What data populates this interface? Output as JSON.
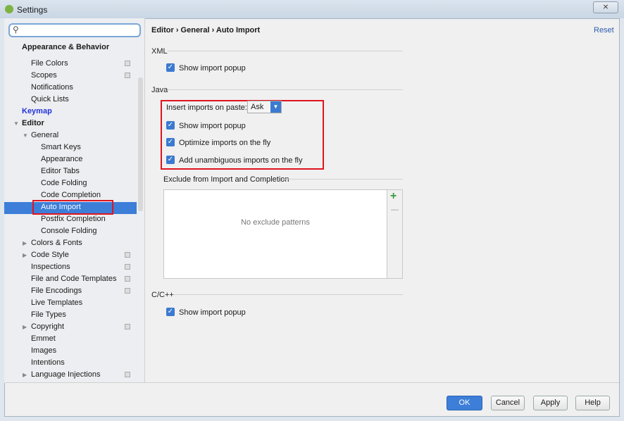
{
  "window": {
    "title": "Settings",
    "close": "⨯"
  },
  "search": {
    "placeholder": ""
  },
  "sidebar": {
    "sticky_header": "Appearance & Behavior",
    "items": [
      {
        "label": "File Colors",
        "level": 2,
        "copy": true
      },
      {
        "label": "Scopes",
        "level": 2,
        "copy": true
      },
      {
        "label": "Notifications",
        "level": 2
      },
      {
        "label": "Quick Lists",
        "level": 2
      },
      {
        "label": "Keymap",
        "level": 1,
        "style": "bold-blue"
      },
      {
        "label": "Editor",
        "level": 1,
        "style": "bold",
        "arrow": "down"
      },
      {
        "label": "General",
        "level": 2,
        "arrow": "down"
      },
      {
        "label": "Smart Keys",
        "level": 3
      },
      {
        "label": "Appearance",
        "level": 3
      },
      {
        "label": "Editor Tabs",
        "level": 3
      },
      {
        "label": "Code Folding",
        "level": 3
      },
      {
        "label": "Code Completion",
        "level": 3
      },
      {
        "label": "Auto Import",
        "level": 3,
        "selected": true
      },
      {
        "label": "Postfix Completion",
        "level": 3
      },
      {
        "label": "Console Folding",
        "level": 3
      },
      {
        "label": "Colors & Fonts",
        "level": 2,
        "arrow": "right"
      },
      {
        "label": "Code Style",
        "level": 2,
        "arrow": "right",
        "copy": true
      },
      {
        "label": "Inspections",
        "level": 2,
        "copy": true
      },
      {
        "label": "File and Code Templates",
        "level": 2,
        "copy": true
      },
      {
        "label": "File Encodings",
        "level": 2,
        "copy": true
      },
      {
        "label": "Live Templates",
        "level": 2
      },
      {
        "label": "File Types",
        "level": 2
      },
      {
        "label": "Copyright",
        "level": 2,
        "arrow": "right",
        "copy": true
      },
      {
        "label": "Emmet",
        "level": 2
      },
      {
        "label": "Images",
        "level": 2
      },
      {
        "label": "Intentions",
        "level": 2
      },
      {
        "label": "Language Injections",
        "level": 2,
        "arrow": "right",
        "copy": true
      }
    ]
  },
  "header": {
    "breadcrumb": "Editor › General › Auto Import",
    "reset": "Reset"
  },
  "xml": {
    "title": "XML",
    "show_popup": "Show import popup"
  },
  "java": {
    "title": "Java",
    "insert_label": "Insert imports on paste:",
    "insert_value": "Ask",
    "show_popup": "Show import popup",
    "optimize": "Optimize imports on the fly",
    "unambiguous": "Add unambiguous imports on the fly"
  },
  "exclude": {
    "title": "Exclude from Import and Completion",
    "empty": "No exclude patterns",
    "add": "+",
    "remove": "—"
  },
  "cpp": {
    "title": "C/C++",
    "show_popup": "Show import popup"
  },
  "buttons": {
    "ok": "OK",
    "cancel": "Cancel",
    "apply": "Apply",
    "help": "Help"
  },
  "colors": {
    "accent": "#3d7ed8",
    "highlight": "#e0141e"
  }
}
